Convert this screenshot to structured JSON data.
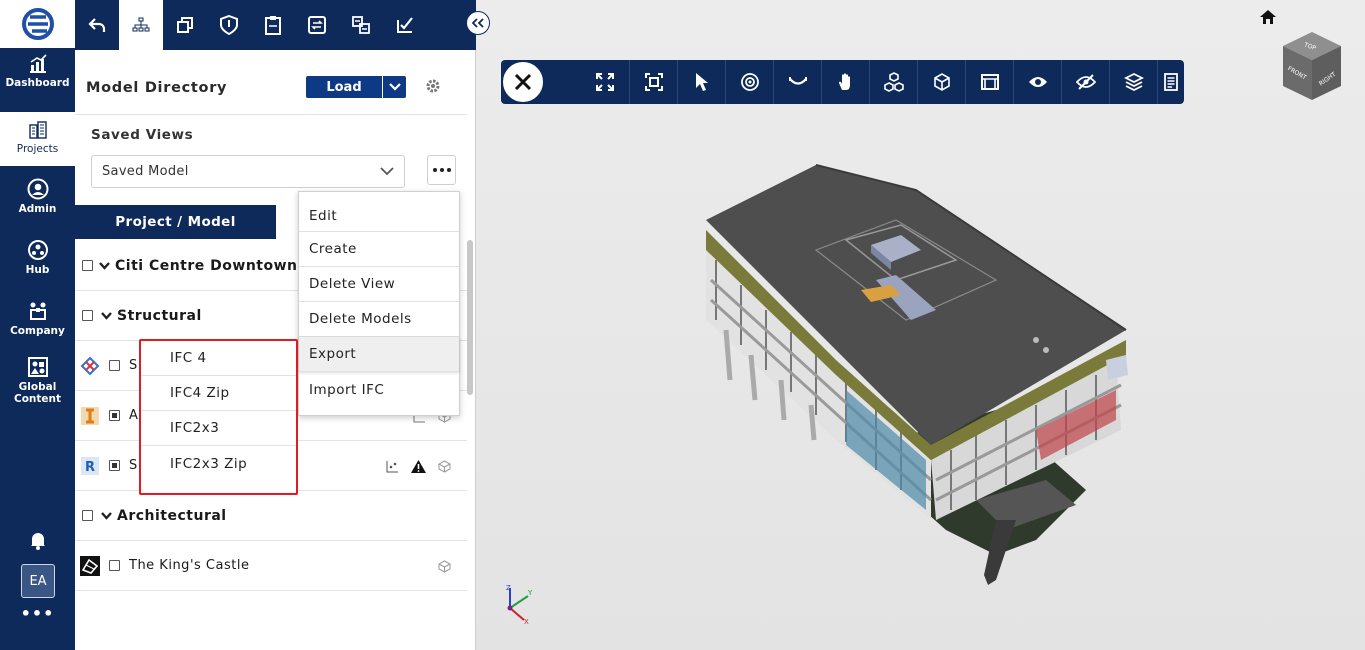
{
  "nav": {
    "items": [
      {
        "label": "Dashboard",
        "icon": "chart-icon"
      },
      {
        "label": "Projects",
        "icon": "buildings-icon"
      },
      {
        "label": "Admin",
        "icon": "user-circle-icon"
      },
      {
        "label": "Hub",
        "icon": "hub-icon"
      },
      {
        "label": "Company",
        "icon": "company-icon"
      },
      {
        "label": "Global\nContent",
        "icon": "global-content-icon"
      }
    ],
    "avatar": "EA",
    "more": "•••"
  },
  "panel": {
    "title": "Model Directory",
    "load_label": "Load",
    "saved_views_label": "Saved Views",
    "saved_views_value": "Saved Model",
    "tab_label": "Project / Model",
    "rows": [
      {
        "name": "Citi Centre Downtown",
        "type": "group"
      },
      {
        "name": "Structural",
        "type": "group"
      },
      {
        "name": "S",
        "type": "model",
        "source": "ifc"
      },
      {
        "name": "A",
        "type": "model",
        "source": "ifc-orange"
      },
      {
        "name": "S",
        "type": "model",
        "source": "revit"
      },
      {
        "name": "Architectural",
        "type": "group"
      },
      {
        "name": "The King's Castle",
        "type": "model",
        "source": "sketch"
      }
    ]
  },
  "menu": {
    "items": [
      "Edit",
      "Create",
      "Delete View",
      "Delete Models",
      "Export",
      "Import IFC"
    ],
    "highlighted": "Export"
  },
  "export_submenu": {
    "items": [
      "IFC 4",
      "IFC4 Zip",
      "IFC2x3",
      "IFC2x3 Zip"
    ]
  },
  "viewer": {
    "tools": [
      "fullscreen-icon",
      "fit-view-icon",
      "select-icon",
      "orbit-icon",
      "look-icon",
      "pan-hand-icon",
      "explode-icon",
      "section-box-icon",
      "section-plane-icon",
      "show-icon",
      "hide-icon",
      "layers-icon",
      "properties-icon"
    ],
    "cube_faces": [
      "TOP",
      "FRONT",
      "RIGHT"
    ],
    "axes": [
      "Z",
      "Y",
      "X"
    ]
  },
  "colors": {
    "nav_bg": "#0e2a5a",
    "accent": "#0e3a85",
    "highlight_border": "#e01b24"
  }
}
